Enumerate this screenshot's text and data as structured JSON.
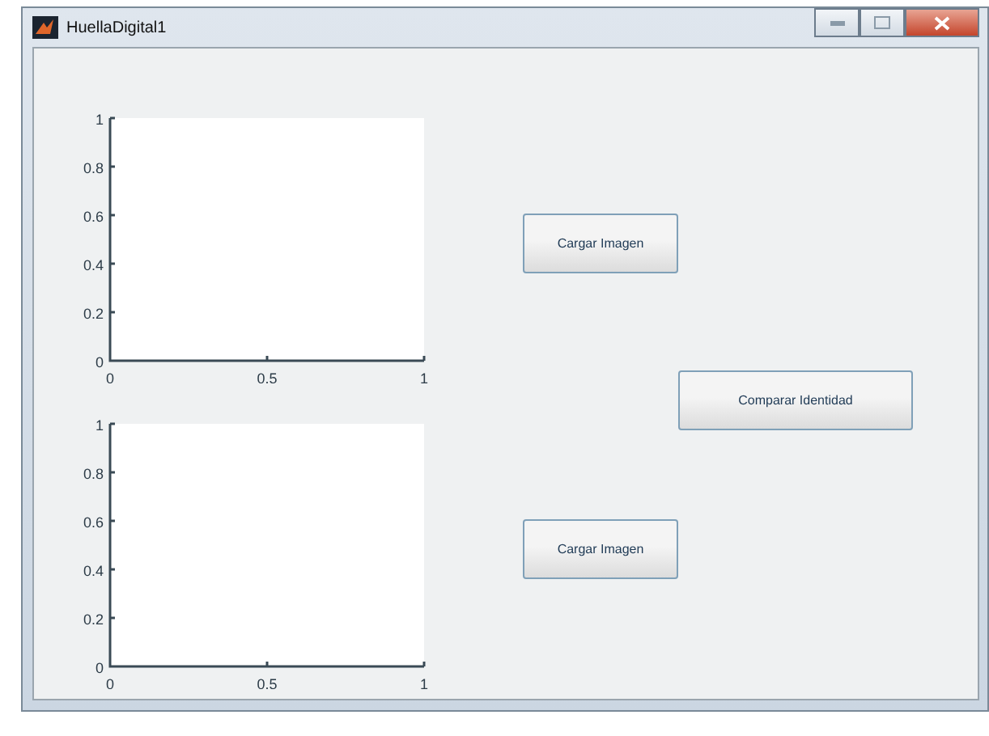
{
  "window": {
    "title": "HuellaDigital1"
  },
  "axes": [
    {
      "chart_data": {
        "type": "line",
        "xlim": [
          0,
          1
        ],
        "ylim": [
          0,
          1
        ],
        "xticks": [
          0,
          0.5,
          1
        ],
        "yticks": [
          0,
          0.2,
          0.4,
          0.6,
          0.8,
          1
        ]
      }
    },
    {
      "chart_data": {
        "type": "line",
        "xlim": [
          0,
          1
        ],
        "ylim": [
          0,
          1
        ],
        "xticks": [
          0,
          0.5,
          1
        ],
        "yticks": [
          0,
          0.2,
          0.4,
          0.6,
          0.8,
          1
        ]
      }
    }
  ],
  "buttons": [
    {
      "label": "Cargar Imagen",
      "kind": "load"
    },
    {
      "label": "Comparar Identidad",
      "kind": "compare"
    },
    {
      "label": "Cargar Imagen",
      "kind": "load"
    }
  ]
}
